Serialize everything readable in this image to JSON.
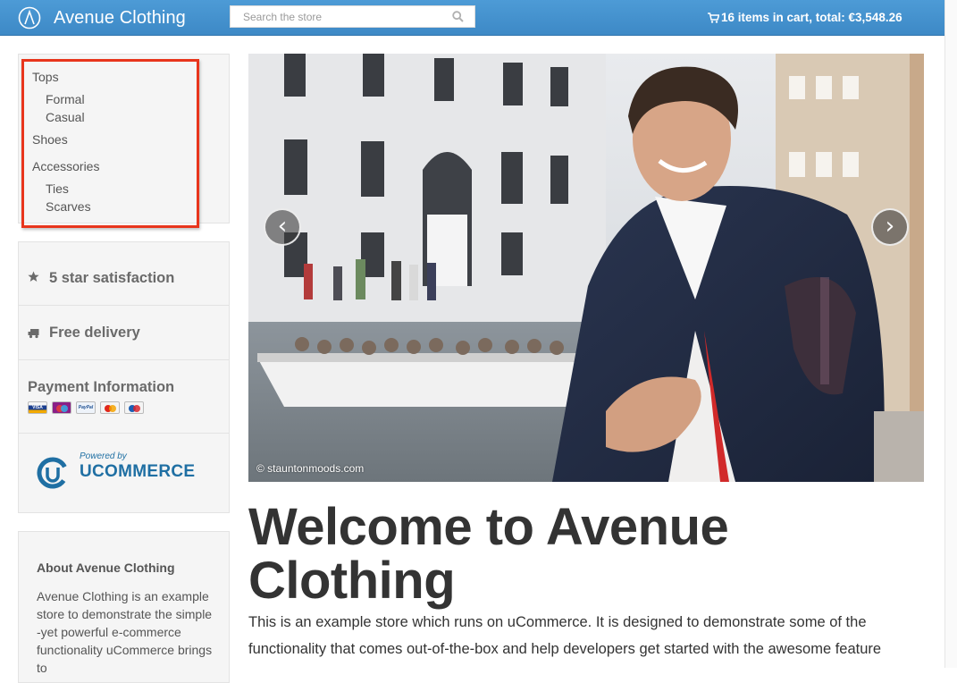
{
  "header": {
    "brand_name": "Avenue Clothing",
    "search_placeholder": "Search the store",
    "cart_text": "16 items in cart, total: €3,548.26"
  },
  "colors": {
    "navbar": "#4592cf",
    "highlight": "#e8351c",
    "panel_bg": "#f5f5f5",
    "ucommerce_blue": "#1f6fa3"
  },
  "icons": {
    "brand": "avenue-logo-icon",
    "search": "search-icon",
    "cart": "cart-icon",
    "star": "star-icon",
    "delivery": "truck-icon",
    "prev": "chevron-left-icon",
    "next": "chevron-right-icon"
  },
  "categories": [
    {
      "label": "Tops",
      "sub": false
    },
    {
      "label": "Formal",
      "sub": true
    },
    {
      "label": "Casual",
      "sub": true
    },
    {
      "label": "Shoes",
      "sub": false
    },
    {
      "label": "Accessories",
      "sub": false
    },
    {
      "label": "Ties",
      "sub": true
    },
    {
      "label": "Scarves",
      "sub": true
    }
  ],
  "features": {
    "satisfaction": "5 star satisfaction",
    "delivery": "Free delivery",
    "payment_title": "Payment Information",
    "payment_cards": [
      "VISA",
      "Maestro",
      "PayPal",
      "MasterCard",
      "Maestro"
    ]
  },
  "ucommerce": {
    "powered_by": "Powered by",
    "name": "UCOMMERCE"
  },
  "about": {
    "title": "About Avenue Clothing",
    "text": "Avenue Clothing is an example store to demonstrate the simple -yet powerful e-commerce functionality uCommerce brings to"
  },
  "carousel": {
    "credit": "© stauntonmoods.com",
    "prev_label": "‹",
    "next_label": "›"
  },
  "main": {
    "title": "Welcome to Avenue Clothing",
    "intro": "This is an example store which runs on uCommerce. It is designed to demonstrate some of the functionality that comes out-of-the-box and help developers get started with the awesome feature"
  }
}
